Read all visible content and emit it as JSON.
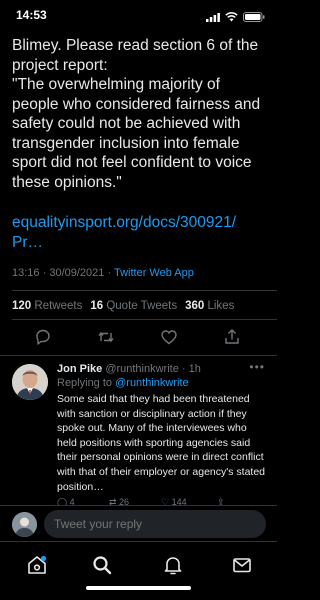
{
  "status_bar": {
    "time": "14:53"
  },
  "tweet": {
    "text": "Blimey.  Please read section 6 of the project report:\n\"The overwhelming majority of people who considered fairness and safety could not be achieved with transgender inclusion into female sport did not feel confident to voice these opinions.\"",
    "link": "equalityinsport.org/docs/300921/\nPr…",
    "time": "13:16",
    "date": "30/09/2021",
    "separator": "·",
    "app": "Twitter Web App",
    "stats": {
      "retweets_count": "120",
      "retweets_label": "Retweets",
      "quotes_count": "16",
      "quotes_label": "Quote Tweets",
      "likes_count": "360",
      "likes_label": "Likes"
    }
  },
  "reply": {
    "name": "Jon Pike",
    "handle": "@runthinkwrite",
    "age": "· 1h",
    "replying_prefix": "Replying to",
    "replying_to": "@runthinkwrite",
    "text": "Some said that they had been threatened with sanction or disciplinary action if they spoke out. Many of the interviewees who held positions with sporting agencies said their personal opinions were in direct conflict with that of their employer or agency's stated position…",
    "counts": {
      "replies": "4",
      "retweets": "26",
      "likes": "144"
    }
  },
  "composer": {
    "placeholder": "Tweet your reply"
  },
  "tabs": [
    "home",
    "search",
    "notifications",
    "messages"
  ],
  "colors": {
    "accent": "#1d9bf0",
    "background": "#000000",
    "text": "#e7e9ea",
    "muted": "#71767b"
  }
}
